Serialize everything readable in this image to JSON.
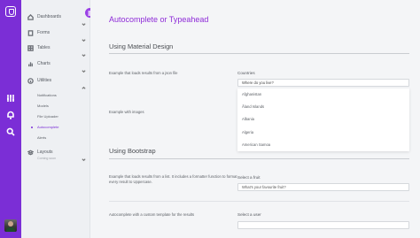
{
  "sidebar": {
    "items": [
      {
        "label": "Dashboards",
        "icon": "home-icon"
      },
      {
        "label": "Forms",
        "icon": "file-icon"
      },
      {
        "label": "Tables",
        "icon": "table-icon"
      },
      {
        "label": "Charts",
        "icon": "bar-chart-icon"
      },
      {
        "label": "Utilities",
        "icon": "info-icon"
      }
    ],
    "sub_items": [
      "Notifications",
      "Models",
      "File Uploader",
      "Autocomplete",
      "Alerts"
    ],
    "layouts": {
      "label": "Layouts",
      "caption": "Coming soon"
    }
  },
  "page": {
    "title": "Autocomplete or Typeahead"
  },
  "material": {
    "title": "Using Material Design",
    "json_desc": "Example that loads results from a json file",
    "images_desc": "Example with images",
    "countries_label": "Countries",
    "countries_value": "Where do you live?",
    "options": [
      "Afghanistan",
      "Åland Islands",
      "Albania",
      "Algeria",
      "American Samoa"
    ]
  },
  "bootstrap": {
    "title": "Using Bootstrap",
    "list_desc": "Example that loads results from a list. It includes a formatter function to format every result to Uppercase.",
    "fruit_label": "Select a fruit",
    "fruit_placeholder": "What's your favourite fruit?",
    "template_desc": "Autocomplete with a custom template for the results",
    "user_label": "Select a user"
  },
  "colors": {
    "accent": "#8e2bd8",
    "rail": "#7b2ed6"
  }
}
